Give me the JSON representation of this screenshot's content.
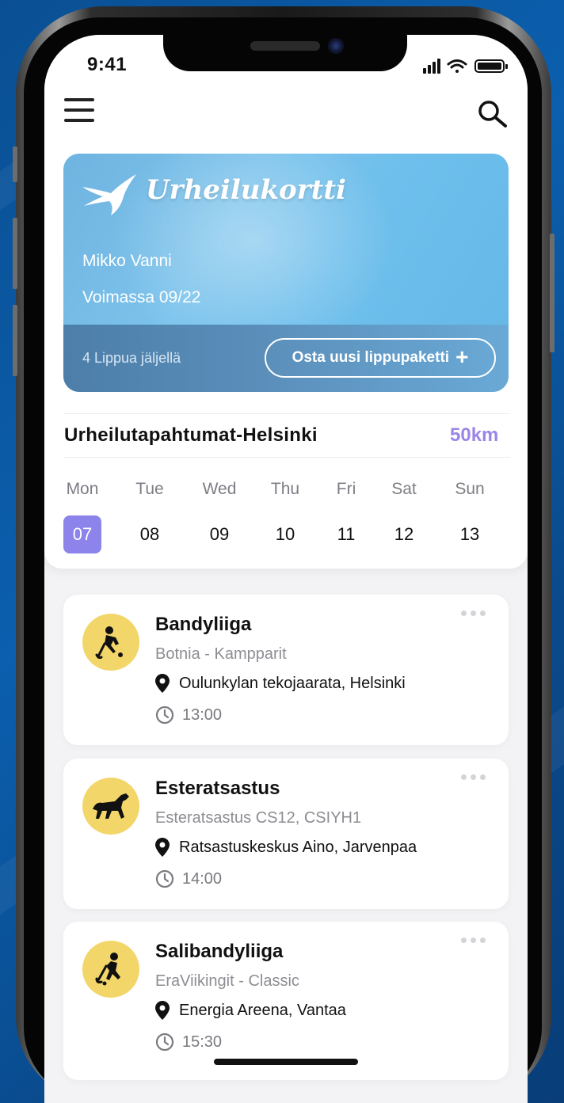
{
  "status_bar": {
    "time": "9:41"
  },
  "card": {
    "brand": "Urheilukortti",
    "holder_name": "Mikko Vanni",
    "validity": "Voimassa 09/22",
    "tickets_left": "4 Lippua jäljellä",
    "buy_button_label": "Osta uusi lippupaketti",
    "buy_button_icon": "+"
  },
  "events_header": {
    "title": "Urheilutapahtumat-Helsinki",
    "radius": "50km"
  },
  "week": [
    {
      "day": "Mon",
      "date": "07",
      "selected": true
    },
    {
      "day": "Tue",
      "date": "08",
      "selected": false
    },
    {
      "day": "Wed",
      "date": "09",
      "selected": false
    },
    {
      "day": "Thu",
      "date": "10",
      "selected": false
    },
    {
      "day": "Fri",
      "date": "11",
      "selected": false
    },
    {
      "day": "Sat",
      "date": "12",
      "selected": false
    },
    {
      "day": "Sun",
      "date": "13",
      "selected": false
    }
  ],
  "events": [
    {
      "title": "Bandyliiga",
      "subtitle": "Botnia - Kampparit",
      "location": "Oulunkylan tekojaarata, Helsinki",
      "time": "13:00",
      "icon": "bandy-player-icon"
    },
    {
      "title": "Esteratsastus",
      "subtitle": "Esteratsastus CS12, CSIYH1",
      "location": "Ratsastuskeskus Aino, Jarvenpaa",
      "time": "14:00",
      "icon": "horse-icon"
    },
    {
      "title": "Salibandyliiga",
      "subtitle": "EraViikingit - Classic",
      "location": "Energia Areena, Vantaa",
      "time": "15:30",
      "icon": "floorball-player-icon"
    }
  ],
  "colors": {
    "accent": "#8c83eb",
    "radius_text": "#9b86e8",
    "avatar_bg": "#f3d66a",
    "card_blue": "#6ebfec"
  }
}
